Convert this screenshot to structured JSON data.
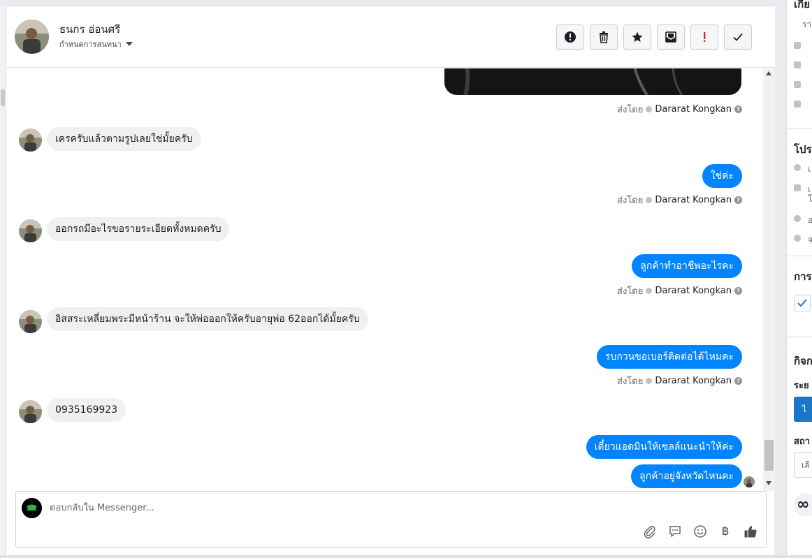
{
  "header": {
    "contact_name": "ธนกร อ่อนศรี",
    "assign_label": "กำหนดการสนทนา",
    "actions": [
      {
        "name": "spam-button",
        "icon": "exclamation-circle-icon"
      },
      {
        "name": "delete-button",
        "icon": "trash-icon"
      },
      {
        "name": "star-button",
        "icon": "star-icon"
      },
      {
        "name": "mark-unread-button",
        "icon": "envelope-icon"
      },
      {
        "name": "follow-up-button",
        "icon": "red-exclamation-icon"
      },
      {
        "name": "mark-done-button",
        "icon": "checkmark-icon"
      }
    ]
  },
  "messages": {
    "sent_by_label": "ส่งโดย",
    "agent_name": "Dararat Kongkan",
    "items": [
      {
        "dir": "in",
        "text": "เครครับแล้วตามรูปเลยใช่มั้ยครับ"
      },
      {
        "dir": "out",
        "text": "ใช่ค่ะ"
      },
      {
        "dir": "in",
        "text": "ออกรถมีอะไรขอรายระเอียดทั้งหมดครับ"
      },
      {
        "dir": "out",
        "text": "ลูกค้าทำอาชีพอะไรคะ"
      },
      {
        "dir": "in",
        "text": "อิสสระเหลี่ยมพระมีหน้าร้าน จะให้พ่อออกให้ครับอายุพ่อ 62ออกได้มั้ยครับ"
      },
      {
        "dir": "out",
        "text": "รบกวนขอเบอร์ติดต่อได้ไหมคะ"
      },
      {
        "dir": "in",
        "text": "0935169923"
      },
      {
        "dir": "out",
        "text": "เดี๋ยวแอดมินให้เซลล์แนะนำให้ค่ะ"
      },
      {
        "dir": "out",
        "text": "ลูกค้าอยู่จังหวัดไหนคะ"
      }
    ]
  },
  "composer": {
    "placeholder": "ตอบกลับใน Messenger...",
    "tools": [
      "paperclip-icon",
      "saved-reply-icon",
      "emoji-icon",
      "baht-icon",
      "thumbs-up-icon"
    ],
    "baht_symbol": "฿"
  },
  "side_panel": {
    "section_titles": [
      "เกีย",
      "โปร",
      "การ",
      "กิจก"
    ],
    "text_fragments": [
      "รา",
      "เ",
      "เ",
      "โ",
      "อ",
      "จ"
    ],
    "sub_labels": [
      "ระย",
      "สถา"
    ],
    "button_label": "ไ",
    "select_value": "เลื",
    "meta_logo": "∞"
  },
  "colors": {
    "outgoing_bubble": "#0084ff",
    "incoming_bubble": "#f0f0f0",
    "side_button": "#1877c9"
  }
}
